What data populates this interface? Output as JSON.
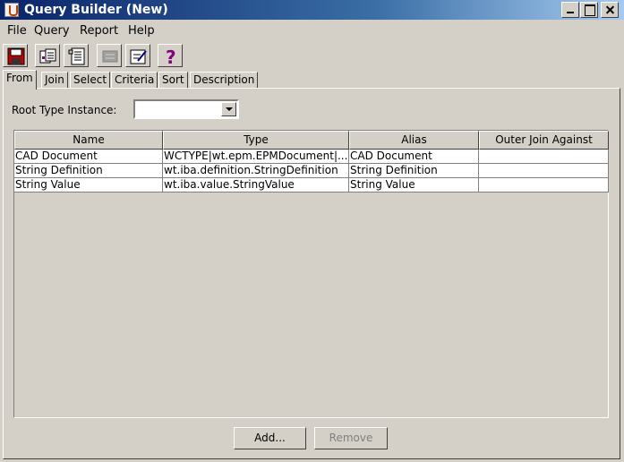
{
  "window": {
    "title": "Query Builder (New)"
  },
  "menu": [
    "File",
    "Query",
    "Report",
    "Help"
  ],
  "toolbar": {
    "icons": [
      "save-icon",
      "query-icon",
      "report-icon",
      "disabled-icon",
      "edit-icon",
      "help-icon"
    ]
  },
  "tabs": [
    "From",
    "Join",
    "Select",
    "Criteria",
    "Sort",
    "Description"
  ],
  "root_type": {
    "label": "Root Type Instance:",
    "value": ""
  },
  "table": {
    "columns": [
      "Name",
      "Type",
      "Alias",
      "Outer Join Against"
    ],
    "rows": [
      [
        "CAD Document",
        "WCTYPE|wt.epm.EPMDocument|...",
        "CAD Document",
        ""
      ],
      [
        "String Definition",
        "wt.iba.definition.StringDefinition",
        "String Definition",
        ""
      ],
      [
        "String Value",
        "wt.iba.value.StringValue",
        "String Value",
        ""
      ]
    ]
  },
  "buttons": {
    "add": "Add...",
    "remove": "Remove"
  }
}
